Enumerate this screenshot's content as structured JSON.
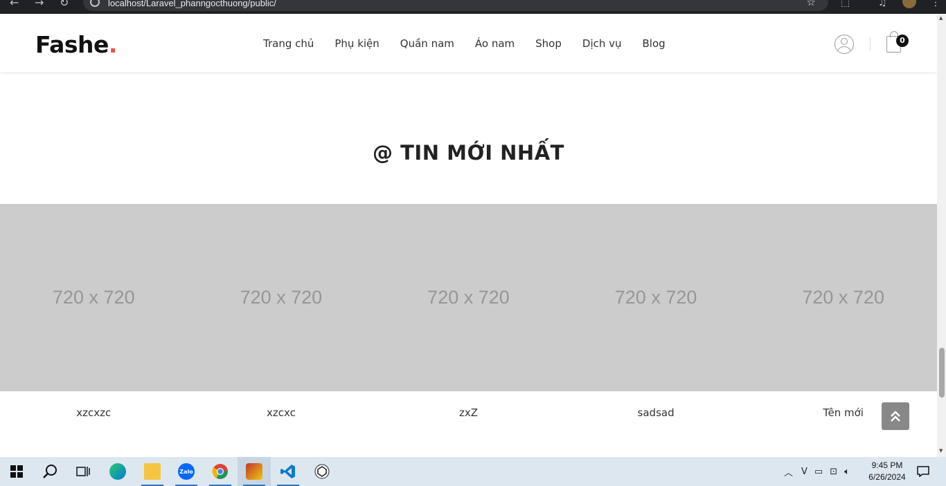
{
  "browser": {
    "url": "localhost/Laravel_phanngocthuong/public/"
  },
  "header": {
    "logo_text": "Fashe",
    "logo_dot": ".",
    "logo_dot_color": "#e65540",
    "nav": [
      {
        "label": "Trang chủ"
      },
      {
        "label": "Phụ kiện"
      },
      {
        "label": "Quần nam"
      },
      {
        "label": "Áo nam"
      },
      {
        "label": "Shop"
      },
      {
        "label": "Dịch vụ"
      },
      {
        "label": "Blog"
      }
    ],
    "cart_count": "0"
  },
  "news": {
    "title": "@ TIN MỚI NHẤT",
    "items": [
      {
        "image_label": "720 x 720",
        "title": "xzcxzc"
      },
      {
        "image_label": "720 x 720",
        "title": "xzcxc"
      },
      {
        "image_label": "720 x 720",
        "title": "zxZ"
      },
      {
        "image_label": "720 x 720",
        "title": "sadsad"
      },
      {
        "image_label": "720 x 720",
        "title": "Tên mới"
      }
    ]
  },
  "taskbar": {
    "apps": [
      {
        "name": "start-icon"
      },
      {
        "name": "search-icon"
      },
      {
        "name": "task-view-icon"
      },
      {
        "name": "edge-icon"
      },
      {
        "name": "file-explorer-icon"
      },
      {
        "name": "zalo-icon",
        "label": "Zalo"
      },
      {
        "name": "chrome-icon"
      },
      {
        "name": "game-icon"
      },
      {
        "name": "vscode-icon"
      },
      {
        "name": "chatgpt-icon"
      }
    ],
    "time": "9:45 PM",
    "date": "6/26/2024"
  }
}
